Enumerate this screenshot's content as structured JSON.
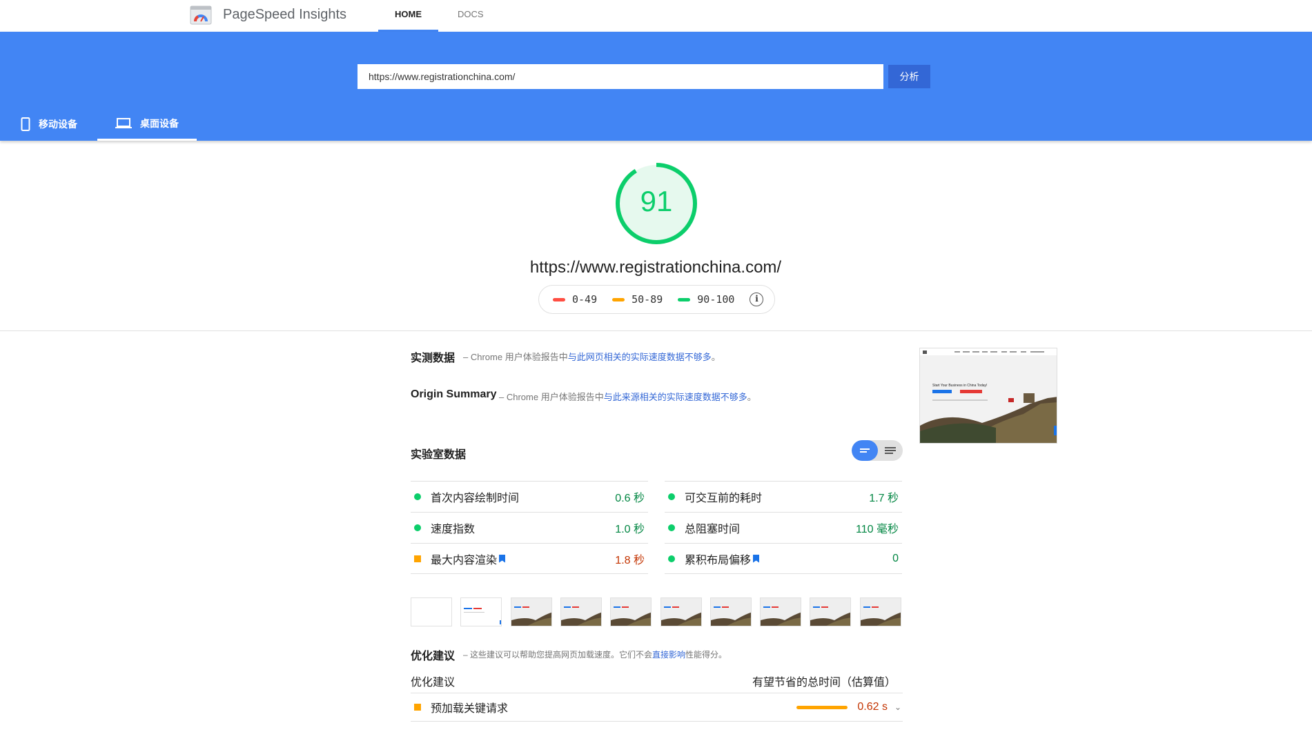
{
  "app": {
    "title": "PageSpeed Insights"
  },
  "nav": {
    "home": "HOME",
    "docs": "DOCS"
  },
  "search": {
    "value": "https://www.registrationchina.com/",
    "button": "分析"
  },
  "device_tabs": {
    "mobile": "移动设备",
    "desktop": "桌面设备"
  },
  "score": {
    "value": "91",
    "url": "https://www.registrationchina.com/",
    "gauge_fraction": 0.91
  },
  "legend": {
    "poor": "0-49",
    "average": "50-89",
    "good": "90-100"
  },
  "colors": {
    "good": "#0cce6b",
    "average": "#ffa400",
    "poor": "#ff4e42",
    "brand": "#4285f4"
  },
  "field": {
    "title": "实测数据",
    "desc_prefix": "– Chrome 用户体验报告中",
    "desc_link": "与此网页相关的实际速度数据不够多",
    "desc_suffix": "。"
  },
  "origin": {
    "title": "Origin Summary",
    "desc_prefix": "– Chrome 用户体验报告中",
    "desc_link": "与此来源相关的实际速度数据不够多",
    "desc_suffix": "。"
  },
  "lab": {
    "title": "实验室数据",
    "metrics_left": [
      {
        "label": "首次内容绘制时间",
        "value": "0.6 秒",
        "status": "good"
      },
      {
        "label": "速度指数",
        "value": "1.0 秒",
        "status": "good"
      },
      {
        "label": "最大内容渲染",
        "value": "1.8 秒",
        "status": "average"
      }
    ],
    "metrics_right": [
      {
        "label": "可交互前的耗时",
        "value": "1.7 秒",
        "status": "good"
      },
      {
        "label": "总阻塞时间",
        "value": "110 毫秒",
        "status": "good"
      },
      {
        "label": "累积布局偏移",
        "value": "0",
        "status": "good"
      }
    ]
  },
  "thumbnail": {
    "headline": "Start Your Business in China Today!"
  },
  "opportunities": {
    "title": "优化建议",
    "desc_prefix": "– 这些建议可以帮助您提高网页加载速度。它们不会",
    "desc_link": "直接影响",
    "desc_suffix": "性能得分。",
    "col_left": "优化建议",
    "col_right": "有望节省的总时间（估算值）",
    "items": [
      {
        "label": "预加载关键请求",
        "value": "0.62 s"
      }
    ]
  }
}
